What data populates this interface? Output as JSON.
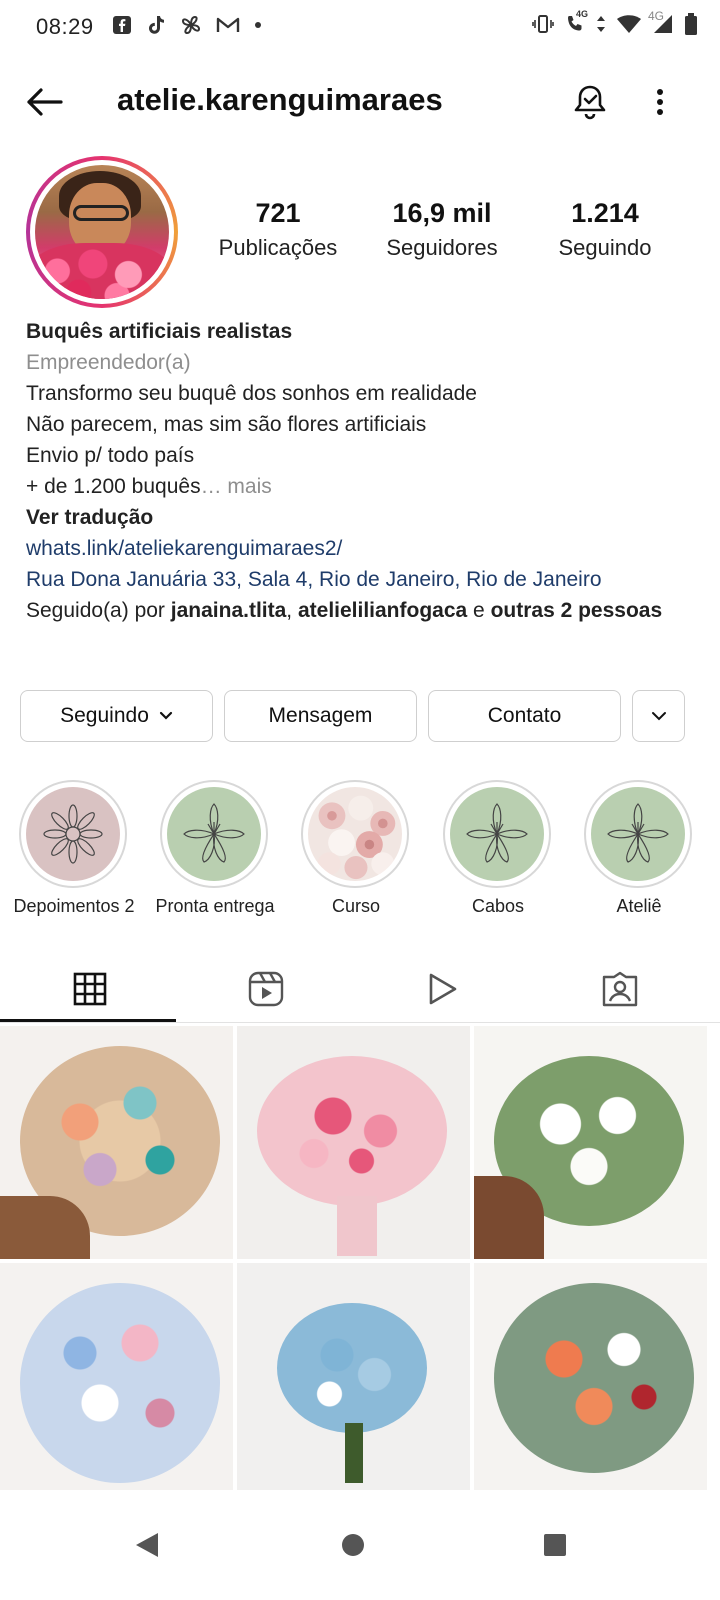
{
  "status_bar": {
    "time": "08:29",
    "left_icons": [
      "facebook-icon",
      "tiktok-icon",
      "pinwheel-icon",
      "gmail-icon",
      "dot-icon"
    ],
    "right_icons": [
      "vibrate-icon",
      "volte-call-icon",
      "data-arrows-icon",
      "wifi-icon",
      "signal-icon",
      "battery-icon"
    ],
    "network_label": "4G",
    "network_label_call": "4G"
  },
  "header": {
    "username": "atelie.karenguimaraes"
  },
  "stats": [
    {
      "value": "721",
      "label": "Publicações"
    },
    {
      "value": "16,9 mil",
      "label": "Seguidores"
    },
    {
      "value": "1.214",
      "label": "Seguindo"
    }
  ],
  "bio": {
    "name": "Buquês artificiais realistas",
    "category": "Empreendedor(a)",
    "lines": [
      "Transformo seu buquê dos sonhos em realidade",
      "Não parecem, mas sim são flores artificiais",
      "Envio p/ todo país"
    ],
    "last_line": "+ de 1.200 buquês",
    "ellipsis": "…",
    "more_label": "mais",
    "translate_label": "Ver tradução",
    "link": "whats.link/ateliekarenguimaraes2/",
    "address": "Rua Dona Januária 33, Sala 4, Rio de Janeiro, Rio de Janeiro",
    "followed_prefix": "Seguido(a) por ",
    "followed_user1": "janaina.tlita",
    "followed_sep": ", ",
    "followed_user2": "atelielilianfogaca",
    "followed_and": " e ",
    "followed_others": "outras 2 pessoas"
  },
  "actions": {
    "following_label": "Seguindo",
    "message_label": "Mensagem",
    "contact_label": "Contato"
  },
  "highlights": [
    {
      "label": "Depoimentos 2"
    },
    {
      "label": "Pronta entrega"
    },
    {
      "label": "Curso"
    },
    {
      "label": "Cabos"
    },
    {
      "label": "Ateliê"
    }
  ],
  "colors": {
    "link": "#1f3c6a",
    "muted": "#8e8e8e",
    "highlight_pink": "#d9c2c2",
    "highlight_green": "#b9cfb0"
  },
  "tabs": [
    "grid-icon",
    "reels-icon",
    "video-icon",
    "tagged-icon"
  ],
  "navbar": [
    "back-nav-icon",
    "home-nav-icon",
    "recents-nav-icon"
  ]
}
